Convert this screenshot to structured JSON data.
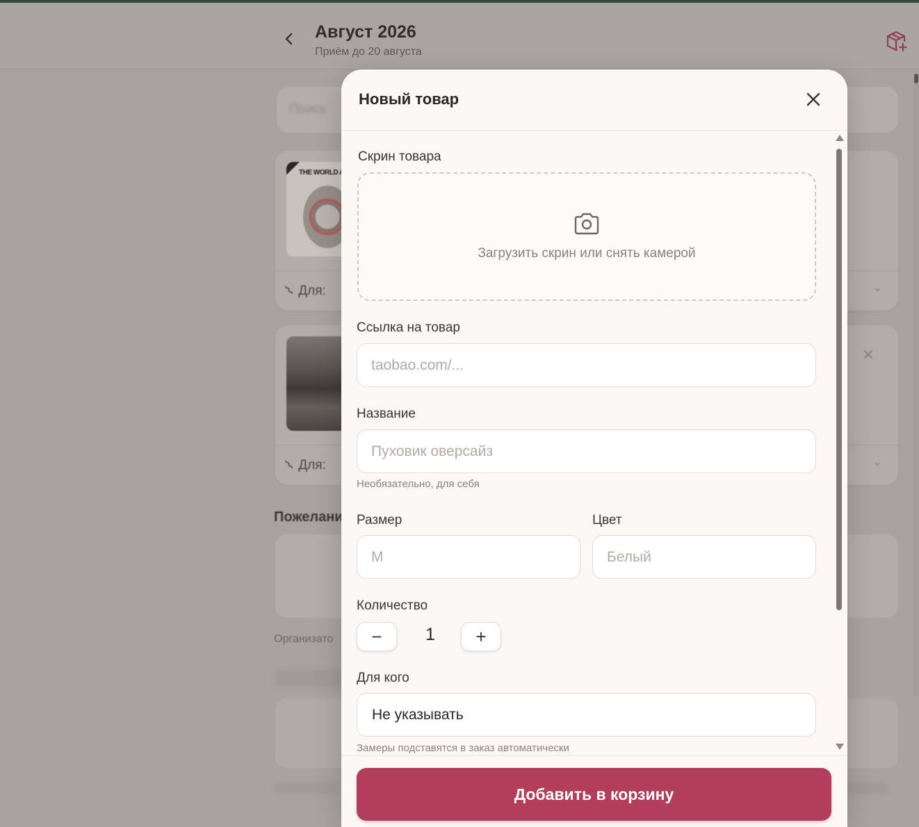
{
  "header": {
    "back_icon": "chevron-left-icon",
    "title": "Август 2026",
    "subtitle": "Приём до 20 августа",
    "cart_icon": "package-plus-icon",
    "accent": "#b33e5b"
  },
  "background": {
    "card1": {
      "for_label": "Для:",
      "thumb_text": "THE WORLD AR"
    },
    "card2": {
      "for_label": "Для:"
    },
    "section_title": "Пожелани",
    "organizer_text": "Организато"
  },
  "modal": {
    "title": "Новый товар",
    "close_icon": "close-icon",
    "screenshot": {
      "label": "Скрин товара",
      "icon": "camera-icon",
      "upload_text": "Загрузить скрин или снять камерой"
    },
    "link": {
      "label": "Ссылка на товар",
      "placeholder": "taobao.com/..."
    },
    "name": {
      "label": "Название",
      "placeholder": "Пуховик оверсайз",
      "hint": "Необязательно, для себя"
    },
    "size": {
      "label": "Размер",
      "placeholder": "M"
    },
    "color": {
      "label": "Цвет",
      "placeholder": "Белый"
    },
    "quantity": {
      "label": "Количество",
      "minus": "−",
      "value": "1",
      "plus": "+"
    },
    "for_whom": {
      "label": "Для кого",
      "value": "Не указывать",
      "hint": "Замеры подставятся в заказ автоматически"
    },
    "submit": "Добавить в корзину"
  }
}
